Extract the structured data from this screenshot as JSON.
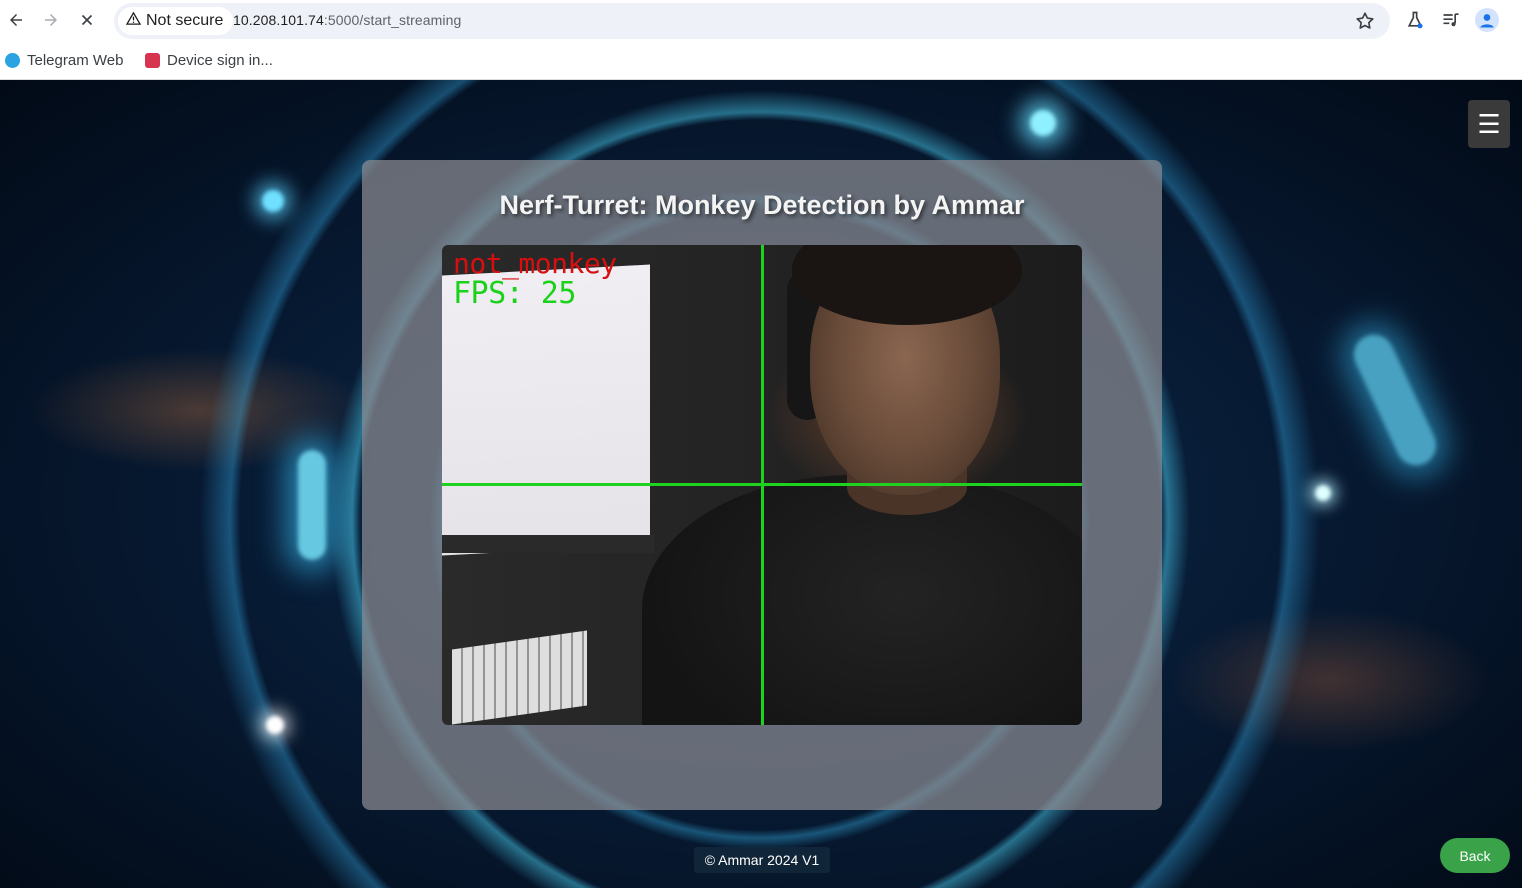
{
  "browser": {
    "security_label": "Not secure",
    "url_host": "10.208.101.74",
    "url_rest": ":5000/start_streaming",
    "icons": [
      "back-icon",
      "forward-icon",
      "stop-loading-icon",
      "warning-icon",
      "star-icon",
      "labs-icon",
      "media-control-icon",
      "profile-icon"
    ],
    "bookmarks": [
      {
        "label": "Telegram Web",
        "icon": "telegram-icon",
        "color": "#2aa3e0"
      },
      {
        "label": "Device sign in...",
        "icon": "device-sign-in-icon",
        "color": "#d6344f"
      }
    ]
  },
  "page": {
    "title": "Nerf-Turret: Monkey Detection by Ammar",
    "stream": {
      "detection_label": "not_monkey",
      "fps_text": "FPS: 25",
      "label_color": "#d70f0f",
      "crosshair_color": "#1fd21f"
    },
    "menu_icon": "☰",
    "footer": "© Ammar 2024 V1",
    "back_label": "Back",
    "back_color": "#3aa34a"
  }
}
